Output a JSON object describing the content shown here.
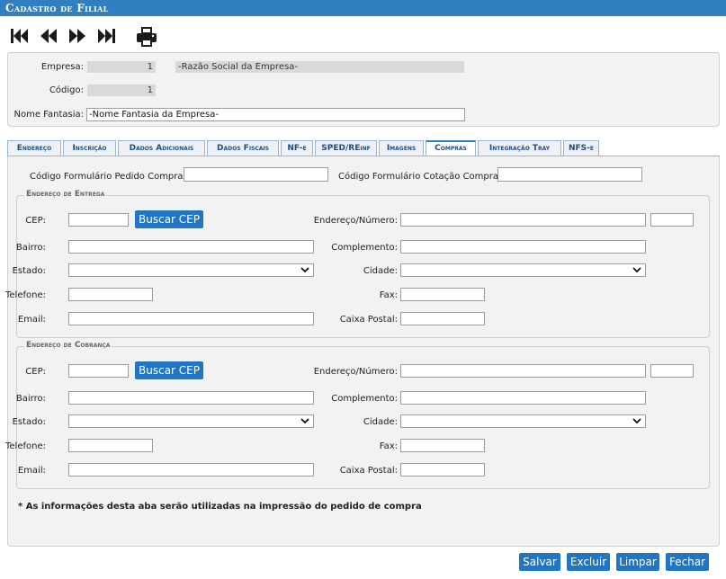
{
  "window": {
    "title": "Cadastro de Filial"
  },
  "toolbar": {
    "first_icon": "first-record-icon",
    "prev_icon": "previous-record-icon",
    "next_icon": "next-record-icon",
    "last_icon": "last-record-icon",
    "print_icon": "printer-icon"
  },
  "header": {
    "empresa_label": "Empresa:",
    "empresa_code": "1",
    "empresa_name": "-Razão Social da Empresa-",
    "codigo_label": "Código:",
    "codigo_value": "1",
    "nome_fantasia_label": "Nome Fantasia:",
    "nome_fantasia_value": "-Nome Fantasia da Empresa-"
  },
  "tabs": [
    {
      "label": "Endereço"
    },
    {
      "label": "Inscrição"
    },
    {
      "label": "Dados Adicionais"
    },
    {
      "label": "Dados Fiscais"
    },
    {
      "label": "NF-e"
    },
    {
      "label": "SPED/REinf"
    },
    {
      "label": "Imagens"
    },
    {
      "label": "Compras"
    },
    {
      "label": "Integração Tray"
    },
    {
      "label": "NFS-e"
    }
  ],
  "compras": {
    "form_pedido_label": "Código Formulário Pedido Compra:",
    "form_cotacao_label": "Código Formulário Cotação Compra:",
    "entrega": {
      "legend": "Endereço de Entrega",
      "cep_label": "CEP:",
      "buscar_cep": "Buscar CEP",
      "endereco_label": "Endereço/Número:",
      "bairro_label": "Bairro:",
      "complemento_label": "Complemento:",
      "estado_label": "Estado:",
      "cidade_label": "Cidade:",
      "telefone_label": "Telefone:",
      "fax_label": "Fax:",
      "email_label": "Email:",
      "caixa_postal_label": "Caixa Postal:"
    },
    "cobranca": {
      "legend": "Endereço de Cobrança",
      "cep_label": "CEP:",
      "buscar_cep": "Buscar CEP",
      "endereco_label": "Endereço/Número:",
      "bairro_label": "Bairro:",
      "complemento_label": "Complemento:",
      "estado_label": "Estado:",
      "cidade_label": "Cidade:",
      "telefone_label": "Telefone:",
      "fax_label": "Fax:",
      "email_label": "Email:",
      "caixa_postal_label": "Caixa Postal:"
    },
    "note": "* As informações desta aba serão utilizadas na impressão do pedido de compra"
  },
  "actions": {
    "salvar": "Salvar",
    "excluir": "Excluir",
    "limpar": "Limpar",
    "fechar": "Fechar"
  },
  "colors": {
    "accent": "#2075c4",
    "titlebar": "#2f7fc1"
  }
}
